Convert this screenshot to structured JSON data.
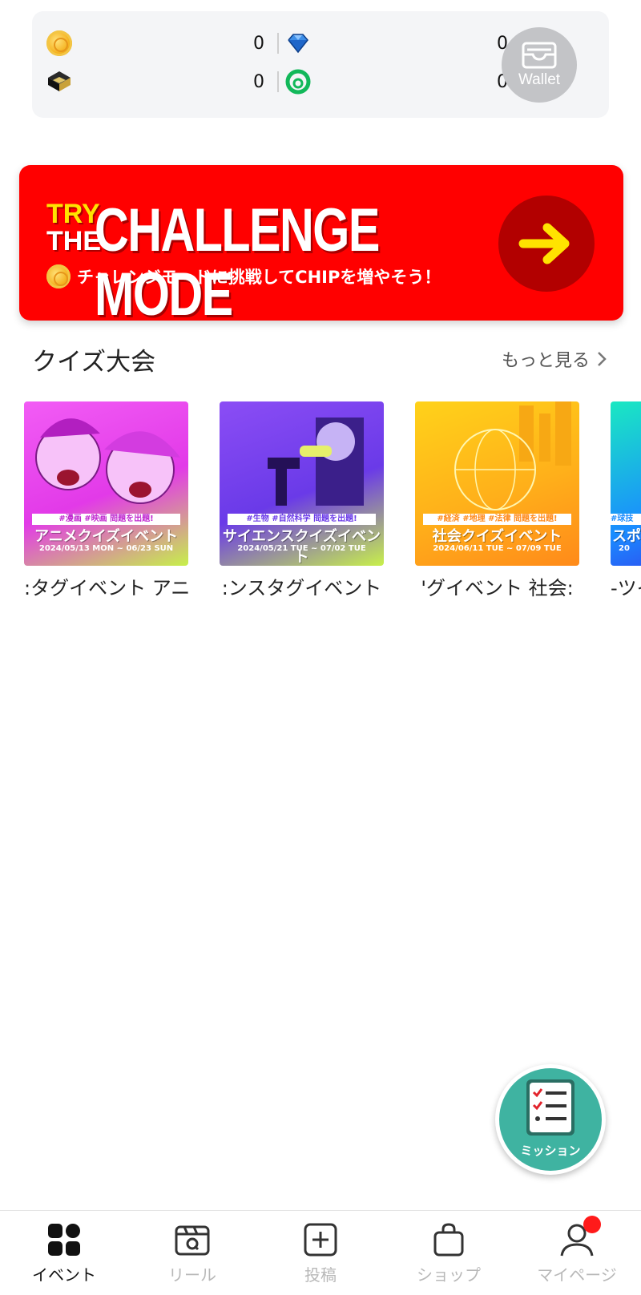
{
  "balances": {
    "coin": "0",
    "gem": "0",
    "stack": "0",
    "token": "0"
  },
  "wallet": {
    "label": "Wallet"
  },
  "banner": {
    "try": "TRY",
    "the": "THE",
    "title": "CHALLENGE MODE",
    "subtitle": "チャレンジモードに挑戦してCHIPを増やそう！"
  },
  "section": {
    "title": "クイズ大会",
    "more": "もっと見る"
  },
  "cards": [
    {
      "caption": ":タグイベント アニ",
      "tags": "#漫画 #映画 問題を出題!",
      "title": "アニメクイズイベント",
      "date": "2024/05/13 MON ~ 06/23 SUN",
      "color": "#e63bf0"
    },
    {
      "caption": ":ンスタグイベント",
      "tags": "#生物 #自然科学 問題を出題!",
      "title": "サイエンスクイズイベント",
      "date": "2024/05/21 TUE ~ 07/02 TUE",
      "color": "#7a4cf2"
    },
    {
      "caption": "'グイベント 社会:",
      "tags": "#経済 #地理 #法律 問題を出題!",
      "title": "社会クイズイベント",
      "date": "2024/06/11 TUE ~ 07/09 TUE",
      "color": "#ff9c1a"
    },
    {
      "caption": "-ツイ",
      "tags": "#球技",
      "title": "スポ",
      "date": "20",
      "color": "#1a8cff"
    }
  ],
  "mission": {
    "label": "ミッション"
  },
  "nav": [
    {
      "label": "イベント",
      "icon": "grid-icon"
    },
    {
      "label": "リール",
      "icon": "reel-icon"
    },
    {
      "label": "投稿",
      "icon": "plus-square-icon"
    },
    {
      "label": "ショップ",
      "icon": "shopping-bag-icon"
    },
    {
      "label": "マイページ",
      "icon": "user-icon"
    }
  ],
  "colors": {
    "banner_red": "#ff0000",
    "arrow_yellow": "#ffe300",
    "mission_teal": "#3fb3a1",
    "notification_red": "#ff1a1a"
  }
}
